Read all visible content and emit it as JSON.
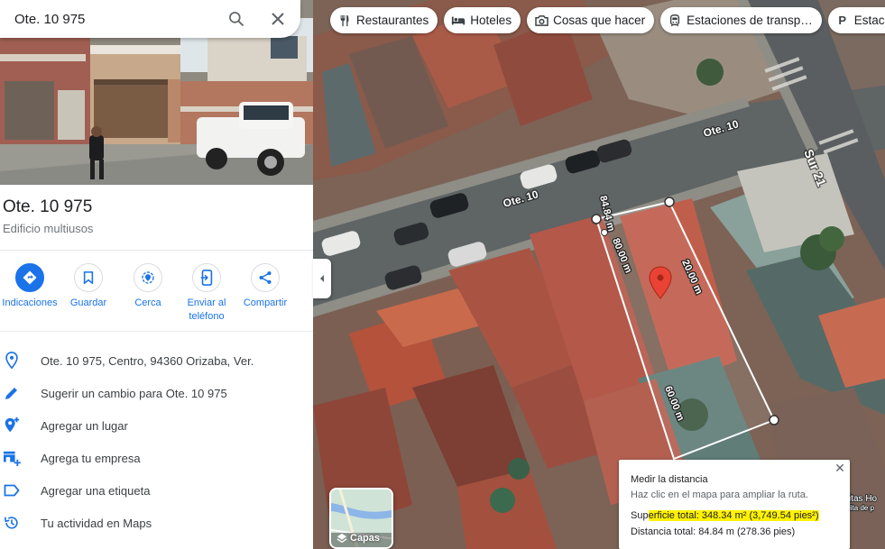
{
  "search": {
    "value": "Ote. 10 975"
  },
  "place": {
    "title": "Ote. 10 975",
    "subtitle": "Edificio multiusos"
  },
  "actions": [
    {
      "label": "Indicaciones",
      "icon": "directions-icon"
    },
    {
      "label": "Guardar",
      "icon": "bookmark-icon"
    },
    {
      "label": "Cerca",
      "icon": "nearby-icon"
    },
    {
      "label": "Enviar al teléfono",
      "icon": "send-to-phone-icon"
    },
    {
      "label": "Compartir",
      "icon": "share-icon"
    }
  ],
  "details": [
    {
      "text": "Ote. 10 975, Centro, 94360 Orizaba, Ver.",
      "icon": "location-pin-icon"
    },
    {
      "text": "Sugerir un cambio para Ote. 10 975",
      "icon": "pencil-icon"
    },
    {
      "text": "Agregar un lugar",
      "icon": "add-place-icon"
    },
    {
      "text": "Agrega tu empresa",
      "icon": "add-business-icon"
    },
    {
      "text": "Agregar una etiqueta",
      "icon": "label-icon"
    },
    {
      "text": "Tu actividad en Maps",
      "icon": "history-icon"
    }
  ],
  "chips": [
    {
      "label": "Restaurantes",
      "icon": "restaurant-icon"
    },
    {
      "label": "Hoteles",
      "icon": "hotel-icon"
    },
    {
      "label": "Cosas que hacer",
      "icon": "camera-icon"
    },
    {
      "label": "Estaciones de transp…",
      "icon": "transit-icon"
    },
    {
      "label": "Estaciona",
      "icon": "parking-icon"
    }
  ],
  "map": {
    "streets": [
      "Ote. 10",
      "Ote. 10",
      "Sur 21"
    ],
    "measurements": [
      "84.84 m",
      "80.00 m",
      "20.00 m",
      "60.00 m"
    ],
    "poi_partial": [
      "itas Ho",
      "lita de p"
    ]
  },
  "layers": {
    "label": "Capas"
  },
  "measure": {
    "title": "Medir la distancia",
    "hint": "Haz clic en el mapa para ampliar la ruta.",
    "area_prefix": "Sup",
    "area_highlight": "erficie total: 348.34 m² (3,749.54 pies²)",
    "distance": "Distancia total: 84.84 m (278.36 pies)"
  },
  "colors": {
    "accent": "#1a73e8",
    "highlight": "#fff200",
    "pin": "#ea4335"
  }
}
